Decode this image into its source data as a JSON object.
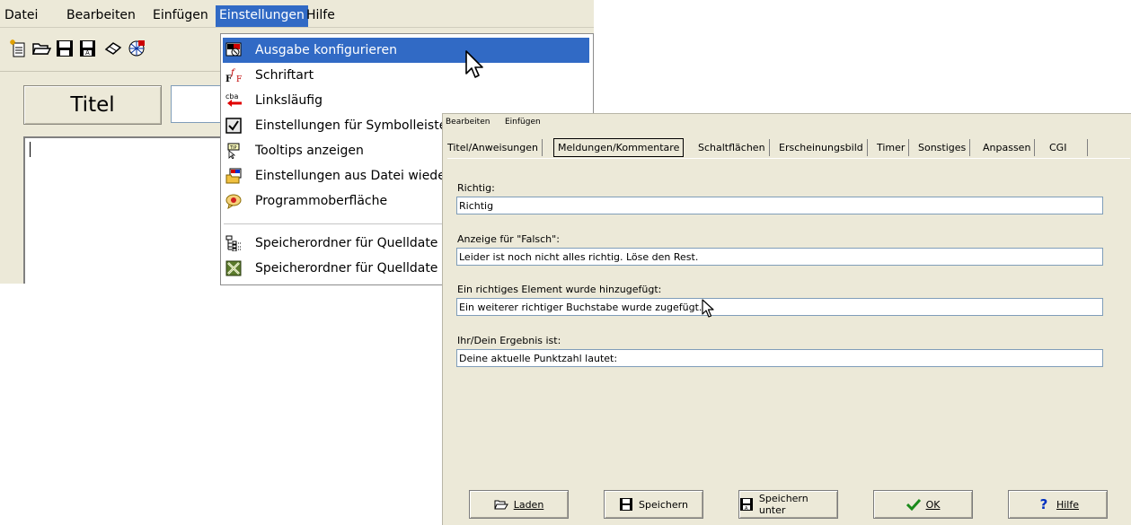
{
  "main": {
    "menu": [
      "Datei",
      "Bearbeiten",
      "Einfügen",
      "Einstellungen",
      "Hilfe"
    ],
    "title_button": "Titel"
  },
  "dropdown": {
    "items": [
      {
        "label": "Ausgabe konfigurieren",
        "icon": "configure-output-icon"
      },
      {
        "label": "Schriftart",
        "icon": "font-icon"
      },
      {
        "label": "Linksläufig",
        "icon": "right-to-left-icon"
      },
      {
        "label": "Einstellungen für Symbolleiste",
        "icon": "toolbar-settings-icon"
      },
      {
        "label": "Tooltips anzeigen",
        "icon": "tooltip-icon"
      },
      {
        "label": "Einstellungen aus Datei wieder",
        "icon": "load-settings-icon"
      },
      {
        "label": "Programmoberfläche",
        "icon": "interface-icon"
      },
      {
        "label": "Speicherordner für Quelldate",
        "icon": "folder-tree-icon"
      },
      {
        "label": "Speicherordner für Quelldate",
        "icon": "folder-x-icon"
      }
    ]
  },
  "dialog": {
    "menu": [
      "Bearbeiten",
      "Einfügen"
    ],
    "tabs": [
      "Titel/Anweisungen",
      "Meldungen/Kommentare",
      "Schaltflächen",
      "Erscheinungsbild",
      "Timer",
      "Sonstiges",
      "Anpassen",
      "CGI"
    ],
    "active_tab": "Meldungen/Kommentare",
    "fields": [
      {
        "label": "Richtig:",
        "value": "Richtig"
      },
      {
        "label": "Anzeige für \"Falsch\":",
        "value": "Leider ist noch nicht alles richtig. Löse den Rest."
      },
      {
        "label": "Ein richtiges Element wurde hinzugefügt:",
        "value": "Ein weiterer richtiger Buchstabe wurde zugefügt."
      },
      {
        "label": "Ihr/Dein Ergebnis ist:",
        "value": "Deine aktuelle Punktzahl lautet:"
      }
    ],
    "buttons": {
      "laden": "Laden",
      "speichern": "Speichern",
      "speichern_unter": "Speichern unter",
      "ok": "OK",
      "hilfe": "Hilfe"
    }
  },
  "colors": {
    "highlight": "#316ac5",
    "window_bg": "#ece9d8"
  }
}
